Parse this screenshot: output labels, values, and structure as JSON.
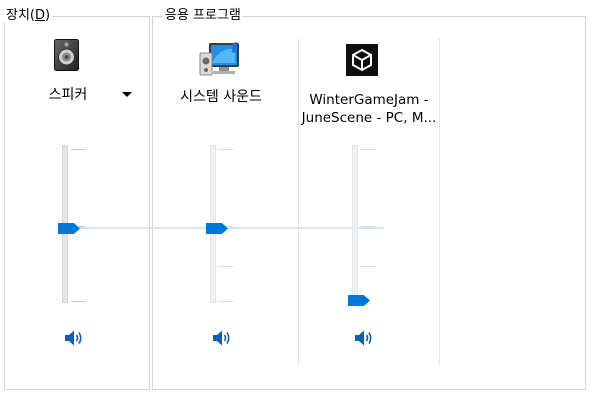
{
  "devices": {
    "title_prefix": "장치(",
    "title_mnemonic": "D",
    "title_suffix": ")",
    "speaker": {
      "label": "스피커",
      "icon": "speaker-icon",
      "volume_fraction": 0.5
    }
  },
  "applications": {
    "title": "응용 프로그램",
    "items": [
      {
        "label": "시스템 사운드",
        "icon": "system-sounds-icon",
        "volume_fraction": 0.5
      },
      {
        "label_line1": "WinterGameJam -",
        "label_line2": "JuneScene - PC, M...",
        "icon": "unity-icon",
        "volume_fraction": 0.0
      }
    ]
  },
  "colors": {
    "accent": "#0078d7",
    "track": "#e3e5e8",
    "border": "#d6d6d6"
  }
}
